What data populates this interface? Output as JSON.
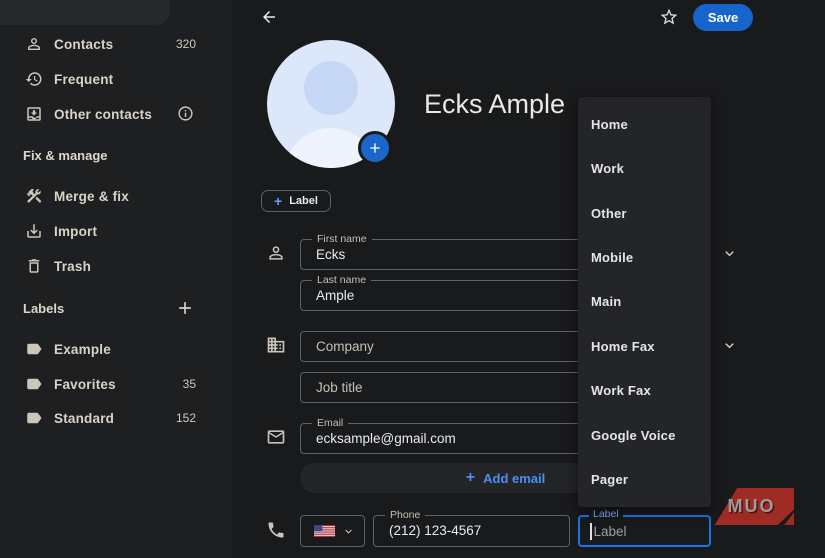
{
  "header": {
    "save_label": "Save"
  },
  "sidebar": {
    "nav": [
      {
        "label": "Contacts",
        "count": "320",
        "icon": "person-icon"
      },
      {
        "label": "Frequent",
        "icon": "history-icon"
      },
      {
        "label": "Other contacts",
        "icon": "inbox-icon",
        "trailing_icon": "info-icon"
      }
    ],
    "fix_manage": {
      "header": "Fix & manage",
      "items": [
        {
          "label": "Merge & fix",
          "icon": "tools-icon"
        },
        {
          "label": "Import",
          "icon": "import-icon"
        },
        {
          "label": "Trash",
          "icon": "trash-icon"
        }
      ]
    },
    "labels_section": {
      "header": "Labels",
      "add_icon": "plus-icon",
      "items": [
        {
          "label": "Example",
          "icon": "label-icon"
        },
        {
          "label": "Favorites",
          "count": "35",
          "icon": "label-icon"
        },
        {
          "label": "Standard",
          "count": "152",
          "icon": "label-icon"
        }
      ]
    }
  },
  "contact": {
    "name": "Ecks Ample",
    "label_chip": "Label",
    "add_photo_icon": "plus-icon"
  },
  "form": {
    "first_name": {
      "label": "First name",
      "value": "Ecks"
    },
    "last_name": {
      "label": "Last name",
      "value": "Ample"
    },
    "company": {
      "placeholder": "Company"
    },
    "job_title": {
      "placeholder": "Job title"
    },
    "email": {
      "label": "Email",
      "value": "ecksample@gmail.com"
    },
    "add_email_label": "Add email",
    "phone": {
      "label": "Phone",
      "value": "(212) 123-4567"
    },
    "label_field": {
      "label": "Label",
      "placeholder": "Label"
    }
  },
  "dropdown": {
    "items": [
      "Home",
      "Work",
      "Other",
      "Mobile",
      "Main",
      "Home Fax",
      "Work Fax",
      "Google Voice",
      "Pager"
    ]
  },
  "watermark": "MUO",
  "colors": {
    "accent_blue": "#4d8ef0",
    "save_blue": "#1765cc",
    "focus_blue": "#1a73e8",
    "avatar_blue": "#dce7fa",
    "watermark_red": "#9e2b24",
    "sidebar_bg": "#1e1f21",
    "main_bg": "#191a1c",
    "menu_bg": "#242528"
  }
}
